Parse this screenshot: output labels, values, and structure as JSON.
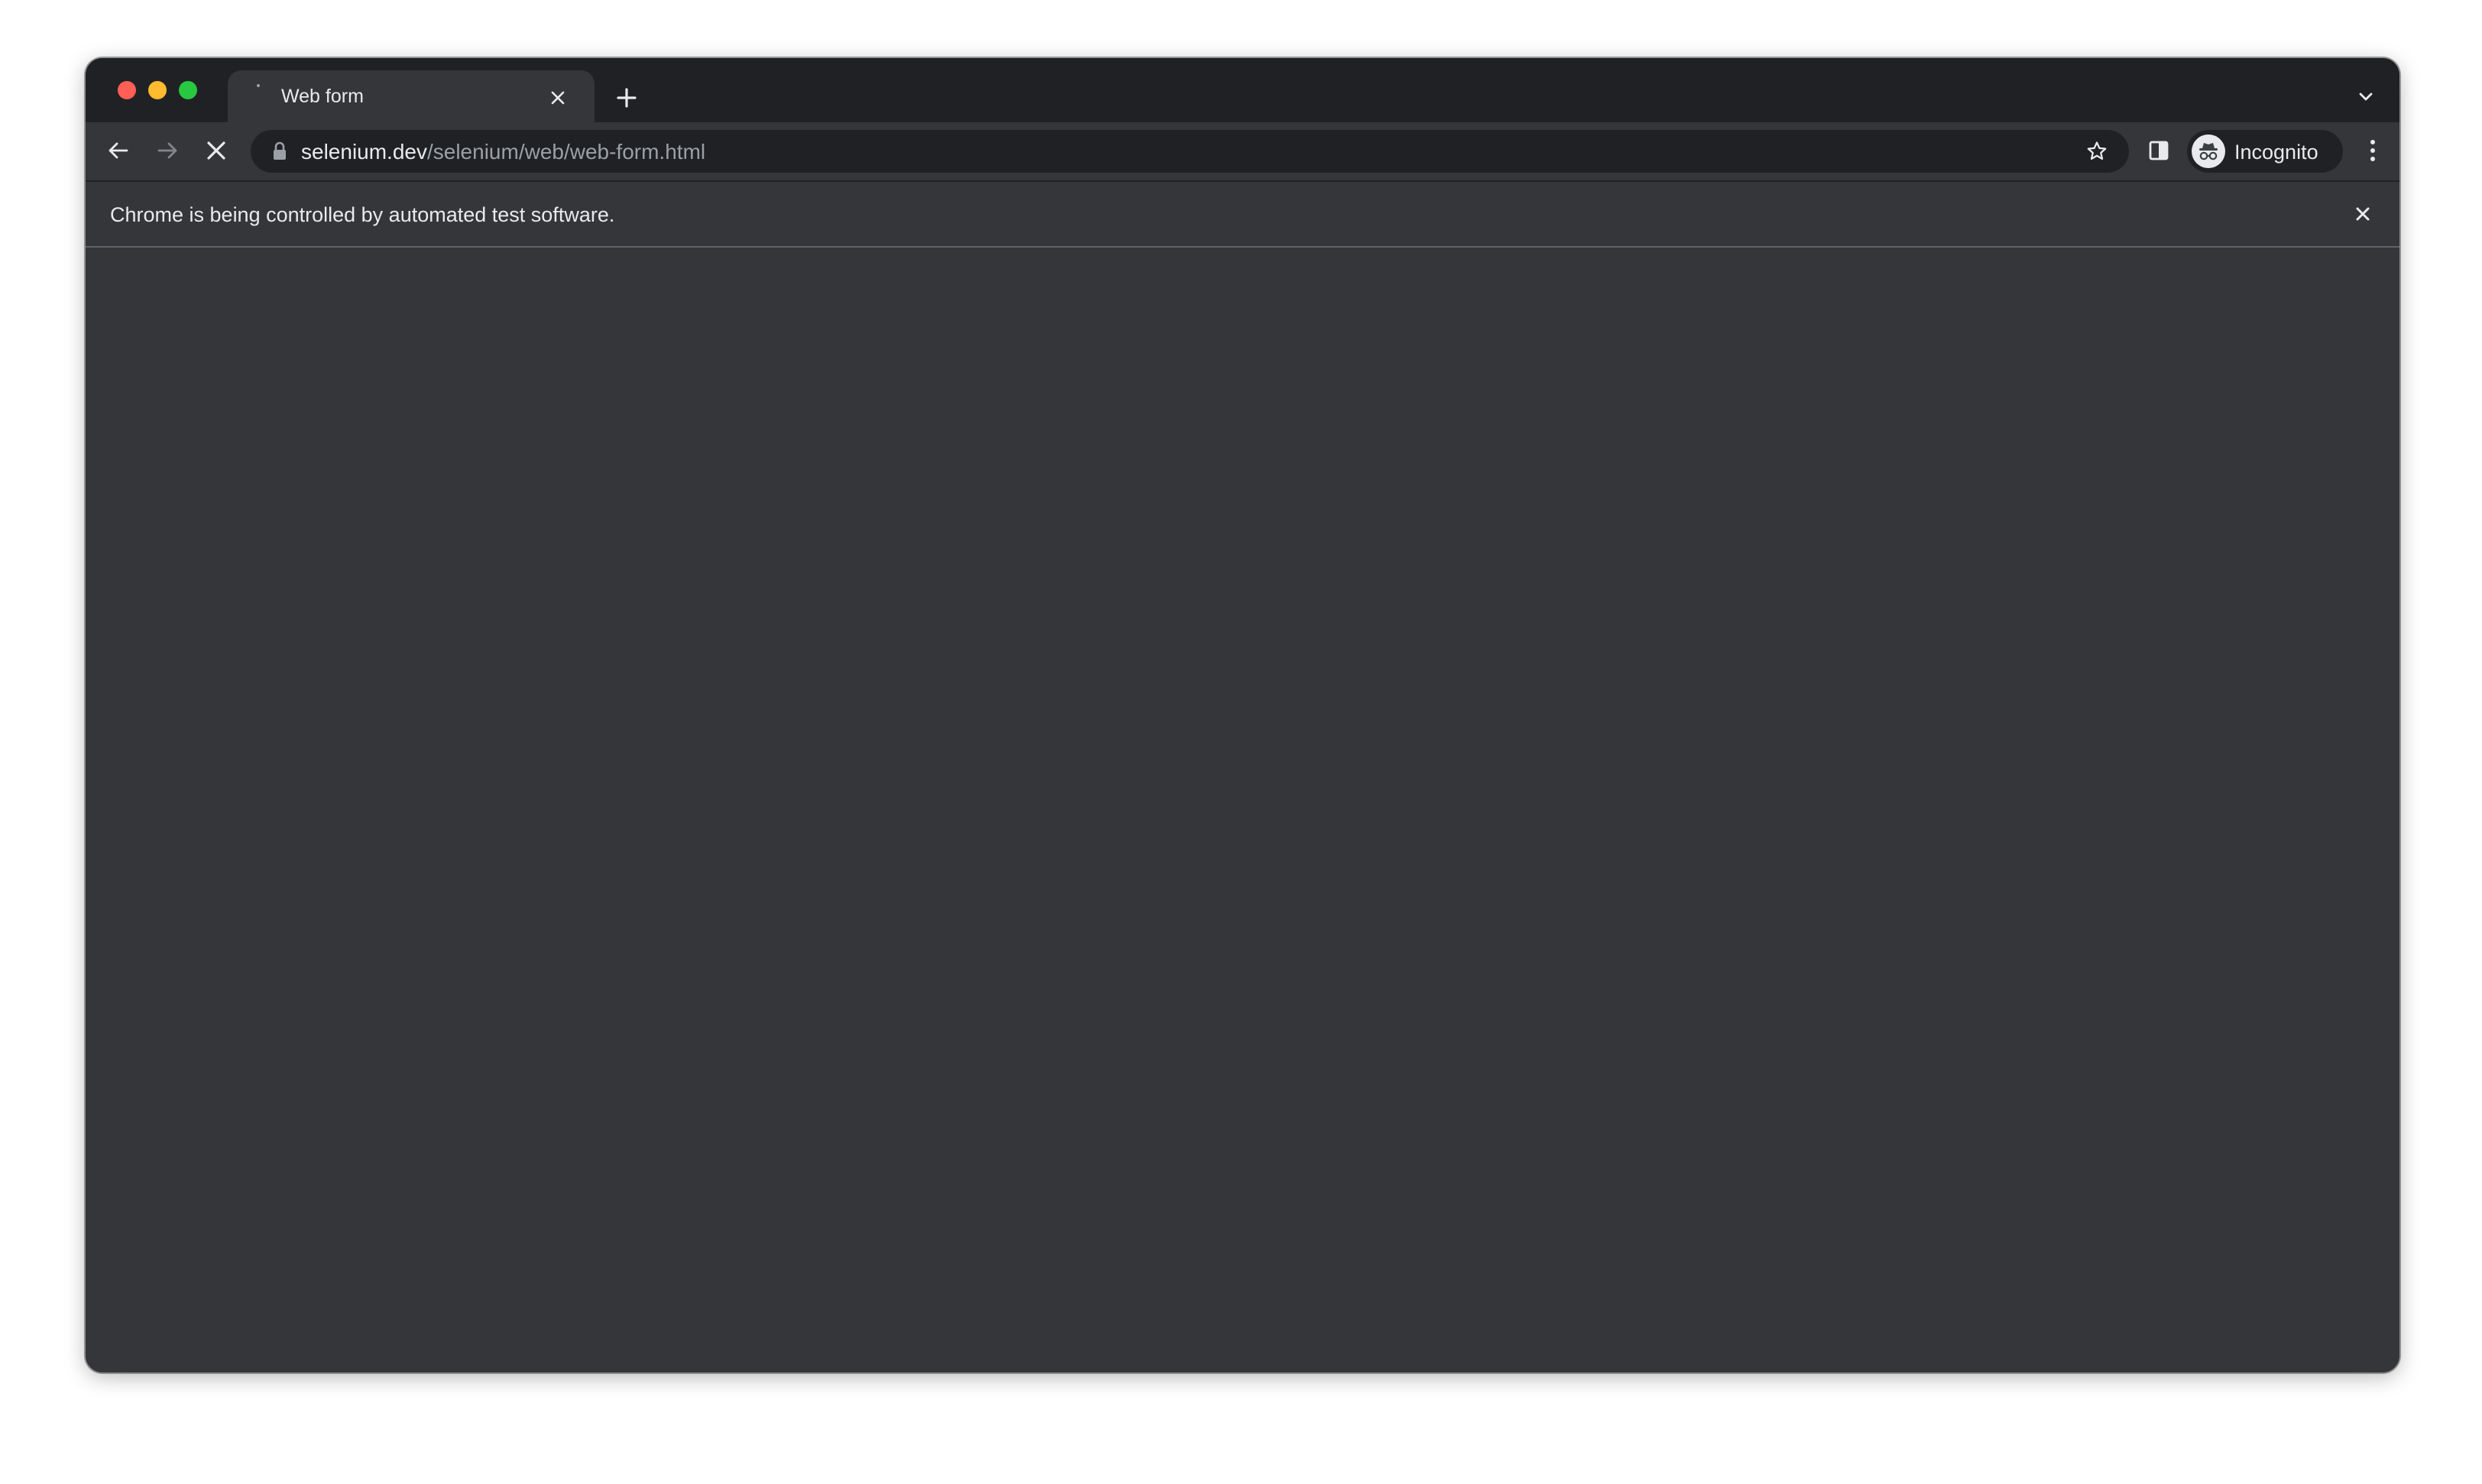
{
  "window": {
    "traffic_lights": [
      "close",
      "minimize",
      "zoom"
    ]
  },
  "tab": {
    "title": "Web form",
    "favicon": "loading-dot-icon",
    "close_icon": "close-icon"
  },
  "tabstrip": {
    "new_tab_icon": "plus-icon",
    "tab_search_icon": "chevron-down-icon"
  },
  "toolbar": {
    "back_icon": "arrow-left-icon",
    "forward_icon": "arrow-right-icon",
    "stop_icon": "close-icon",
    "url_host": "selenium.dev",
    "url_path": "/selenium/web/web-form.html",
    "lock_icon": "lock-icon",
    "bookmark_icon": "star-icon",
    "side_panel_icon": "side-panel-icon",
    "profile_label": "Incognito",
    "profile_icon": "incognito-icon",
    "menu_icon": "more-vert-icon"
  },
  "infobar": {
    "message": "Chrome is being controlled by automated test software.",
    "close_icon": "close-icon"
  },
  "colors": {
    "frame": "#202124",
    "toolbar": "#35363a",
    "text": "#e8eaed",
    "muted_text": "#9aa0a6"
  }
}
